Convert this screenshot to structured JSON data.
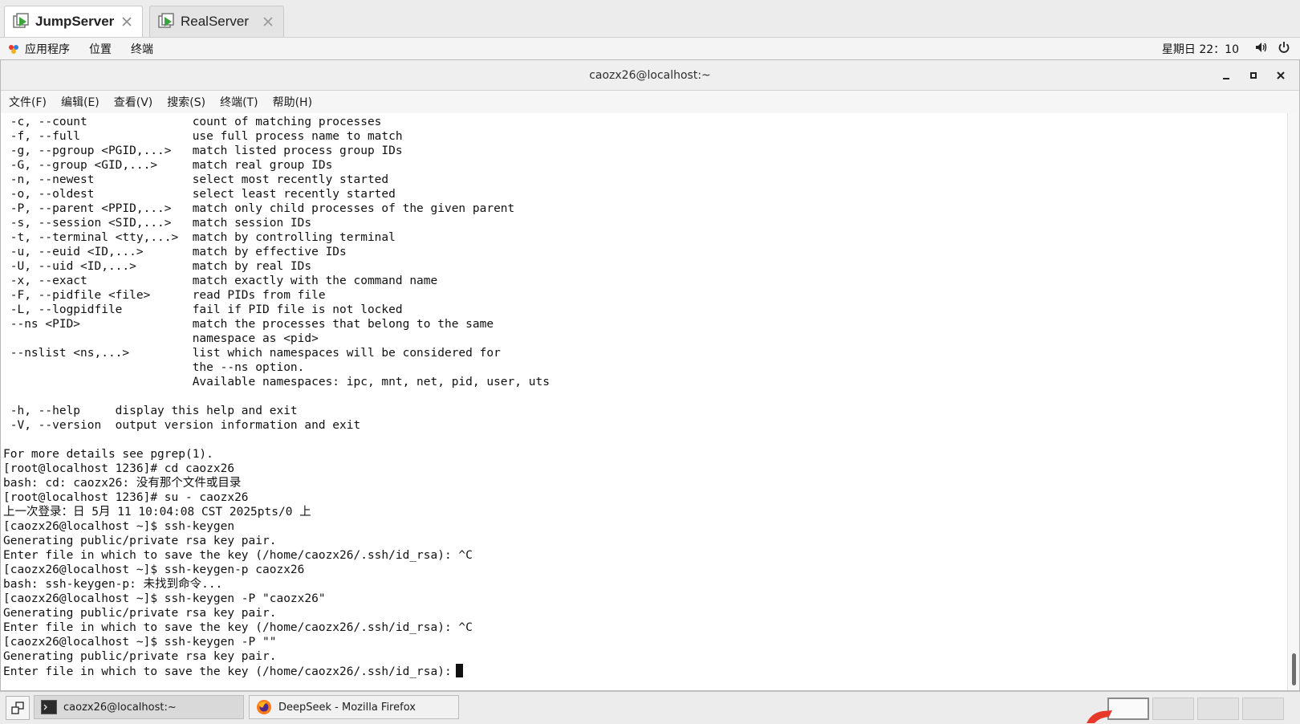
{
  "tabs": [
    {
      "label": "JumpServer",
      "active": true
    },
    {
      "label": "RealServer",
      "active": false
    }
  ],
  "topbar": {
    "menu": [
      "应用程序",
      "位置",
      "终端"
    ],
    "clock": "星期日 22：10"
  },
  "window": {
    "title": "caozx26@localhost:~",
    "menu": [
      "文件(F)",
      "编辑(E)",
      "查看(V)",
      "搜索(S)",
      "终端(T)",
      "帮助(H)"
    ]
  },
  "terminal": {
    "lines": [
      " -c, --count               count of matching processes",
      " -f, --full                use full process name to match",
      " -g, --pgroup <PGID,...>   match listed process group IDs",
      " -G, --group <GID,...>     match real group IDs",
      " -n, --newest              select most recently started",
      " -o, --oldest              select least recently started",
      " -P, --parent <PPID,...>   match only child processes of the given parent",
      " -s, --session <SID,...>   match session IDs",
      " -t, --terminal <tty,...>  match by controlling terminal",
      " -u, --euid <ID,...>       match by effective IDs",
      " -U, --uid <ID,...>        match by real IDs",
      " -x, --exact               match exactly with the command name",
      " -F, --pidfile <file>      read PIDs from file",
      " -L, --logpidfile          fail if PID file is not locked",
      " --ns <PID>                match the processes that belong to the same",
      "                           namespace as <pid>",
      " --nslist <ns,...>         list which namespaces will be considered for",
      "                           the --ns option.",
      "                           Available namespaces: ipc, mnt, net, pid, user, uts",
      "",
      " -h, --help     display this help and exit",
      " -V, --version  output version information and exit",
      "",
      "For more details see pgrep(1).",
      "[root@localhost 1236]# cd caozx26",
      "bash: cd: caozx26: 没有那个文件或目录",
      "[root@localhost 1236]# su - caozx26",
      "上一次登录：日 5月 11 10:04:08 CST 2025pts/0 上",
      "[caozx26@localhost ~]$ ssh-keygen",
      "Generating public/private rsa key pair.",
      "Enter file in which to save the key (/home/caozx26/.ssh/id_rsa): ^C",
      "[caozx26@localhost ~]$ ssh-keygen-p caozx26",
      "bash: ssh-keygen-p: 未找到命令...",
      "[caozx26@localhost ~]$ ssh-keygen -P \"caozx26\"",
      "Generating public/private rsa key pair.",
      "Enter file in which to save the key (/home/caozx26/.ssh/id_rsa): ^C",
      "[caozx26@localhost ~]$ ssh-keygen -P \"\"",
      "Generating public/private rsa key pair.",
      "Enter file in which to save the key (/home/caozx26/.ssh/id_rsa):"
    ]
  },
  "taskbar": {
    "tasks": [
      {
        "label": "caozx26@localhost:~",
        "icon": "terminal-icon"
      },
      {
        "label": "DeepSeek - Mozilla Firefox",
        "icon": "firefox-icon"
      }
    ],
    "workspaces": 4
  },
  "colors": {
    "tab_icon_green": "#3aa63a",
    "firefox_orange": "#ff7a1a",
    "accent_red": "#e8382a"
  }
}
